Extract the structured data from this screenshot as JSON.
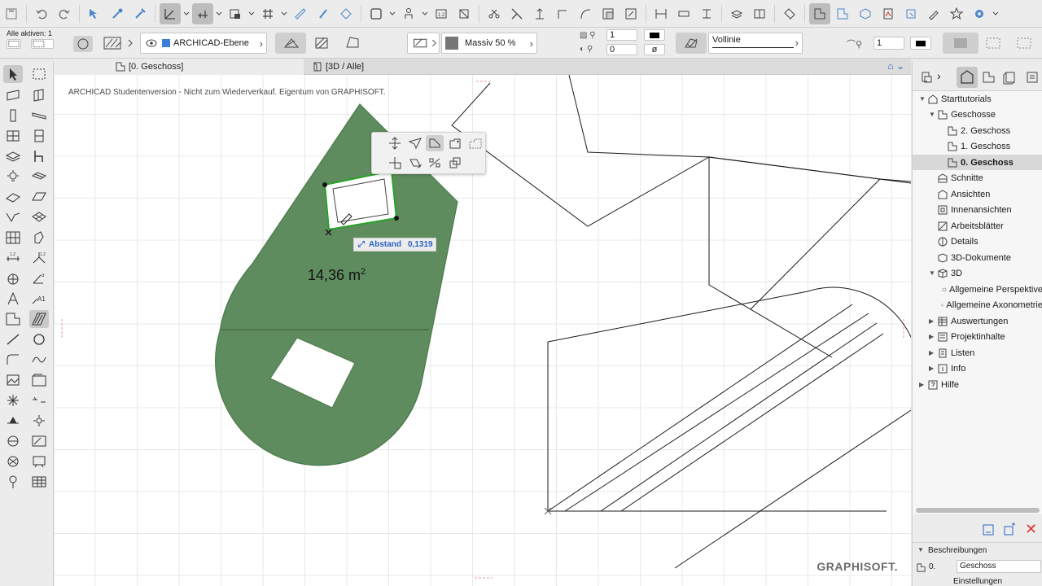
{
  "toolbar": {
    "icons": [
      "save-icon",
      "undo-icon",
      "redo-icon",
      "select-tool-icon",
      "eyedropper-icon",
      "inject-icon",
      "arrow-tool-icon",
      "grid-snap-icon",
      "layer-icon",
      "grid-icon",
      "ruler-icon",
      "pen-icon",
      "trace-icon",
      "box-icon",
      "person-icon",
      "counter-icon",
      "magic-wand-icon",
      "scissors-icon",
      "split-icon",
      "adjust-icon",
      "offset-icon",
      "curve-icon",
      "resize-icon",
      "rotate-icon",
      "stretch-icon",
      "elevate-icon",
      "align-icon",
      "layer-combo-icon",
      "teamwork-icon",
      "tag-icon",
      "floor-plan-icon",
      "section-icon",
      "3d-icon",
      "pdf-icon",
      "publish-icon",
      "marker-icon",
      "favorite-icon",
      "settings-icon"
    ]
  },
  "infobox": {
    "selection_count": "Alle aktiven: 1",
    "layer": "ARCHICAD-Ebene",
    "fill": "Massiv 50 %",
    "pen_fg": "1",
    "pen_bg": "0",
    "line_type": "Vollinie",
    "contour_pen": "1"
  },
  "tabs": [
    {
      "label": "[0. Geschoss]",
      "active": true
    },
    {
      "label": "[3D / Alle]",
      "active": false
    }
  ],
  "canvas": {
    "watermark": "ARCHICAD Studentenversion - Nicht zum Wiederverkauf. Eigentum von GRAPHISOFT.",
    "area_value": "14,36 m",
    "area_unit_sup": "2",
    "tracker_label": "Abstand",
    "tracker_value": "0,1319",
    "brand": "GRAPHISOFT.",
    "colors": {
      "fill_green": "#5f8c5f",
      "edge": "#4a7a4a",
      "highlight": "#27a327",
      "tracker_text": "#2a63c6"
    }
  },
  "navigator": {
    "tree": [
      {
        "label": "Starttutorials",
        "level": 0,
        "arrow": "▼",
        "icon": "project-icon"
      },
      {
        "label": "Geschosse",
        "level": 1,
        "arrow": "▼",
        "icon": "stories-icon"
      },
      {
        "label": "2. Geschoss",
        "level": 2,
        "arrow": "",
        "icon": "story-icon"
      },
      {
        "label": "1. Geschoss",
        "level": 2,
        "arrow": "",
        "icon": "story-icon"
      },
      {
        "label": "0. Geschoss",
        "level": 2,
        "arrow": "",
        "icon": "story-icon",
        "selected": true
      },
      {
        "label": "Schnitte",
        "level": 1,
        "arrow": "",
        "icon": "section-icon"
      },
      {
        "label": "Ansichten",
        "level": 1,
        "arrow": "",
        "icon": "elevation-icon"
      },
      {
        "label": "Innenansichten",
        "level": 1,
        "arrow": "",
        "icon": "interior-icon"
      },
      {
        "label": "Arbeitsblätter",
        "level": 1,
        "arrow": "",
        "icon": "worksheet-icon"
      },
      {
        "label": "Details",
        "level": 1,
        "arrow": "",
        "icon": "detail-icon"
      },
      {
        "label": "3D-Dokumente",
        "level": 1,
        "arrow": "",
        "icon": "3d-document-icon"
      },
      {
        "label": "3D",
        "level": 1,
        "arrow": "▼",
        "icon": "cube-icon"
      },
      {
        "label": "Allgemeine Perspektive",
        "level": 2,
        "arrow": "",
        "icon": "perspective-icon"
      },
      {
        "label": "Allgemeine Axonometrie",
        "level": 2,
        "arrow": "",
        "icon": "axonometry-icon"
      },
      {
        "label": "Auswertungen",
        "level": 1,
        "arrow": "▶",
        "icon": "schedule-icon"
      },
      {
        "label": "Projektinhalte",
        "level": 1,
        "arrow": "▶",
        "icon": "index-icon"
      },
      {
        "label": "Listen",
        "level": 1,
        "arrow": "▶",
        "icon": "list-icon"
      },
      {
        "label": "Info",
        "level": 1,
        "arrow": "▶",
        "icon": "info-icon"
      },
      {
        "label": "Hilfe",
        "level": 0,
        "arrow": "▶",
        "icon": "help-icon"
      }
    ],
    "descriptions_label": "Beschreibungen",
    "story_number": "0.",
    "story_name": "Geschoss",
    "settings_label": "Einstellungen"
  }
}
